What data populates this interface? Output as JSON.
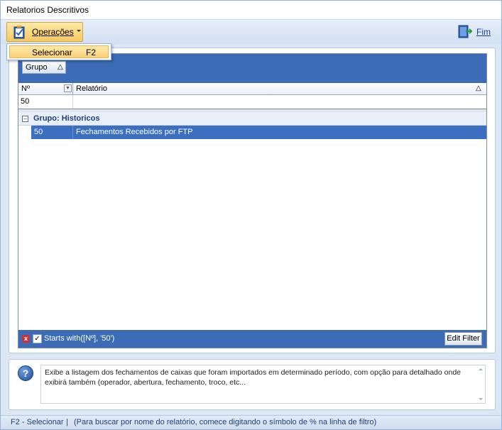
{
  "window": {
    "title": "Relatorios Descritivos"
  },
  "toolbar": {
    "operations_label": "Operações",
    "exit_label": "Fim"
  },
  "menu": {
    "items": [
      {
        "label": "Selecionar",
        "shortcut": "F2"
      }
    ]
  },
  "grid": {
    "group_chip": "Grupo",
    "columns": [
      {
        "label": "Nº"
      },
      {
        "label": "Relatório"
      }
    ],
    "filter_row": {
      "no": "50",
      "relatorio": ""
    },
    "group_row": "Grupo: Historicos",
    "rows": [
      {
        "no": "50",
        "relatorio": "Fechamentos Recebidos por FTP"
      }
    ],
    "filter_text": "Starts with([Nº], '50')",
    "edit_filter_label": "Edit Filter"
  },
  "description": {
    "text": "Exibe a listagem dos fechamentos de caixas que foram importados em determinado período, com opção para detalhado onde exibirá também (operador, abertura, fechamento, troco, etc..."
  },
  "status": {
    "shortcut": "F2 - Selecionar",
    "separator": "|",
    "hint": "(Para buscar por nome do relatório, comece digitando o símbolo de % na linha de filtro)"
  },
  "colors": {
    "accent_blue": "#3b6cb5",
    "selection_blue": "#3a6fc2",
    "button_orange": "#f8c95a"
  }
}
